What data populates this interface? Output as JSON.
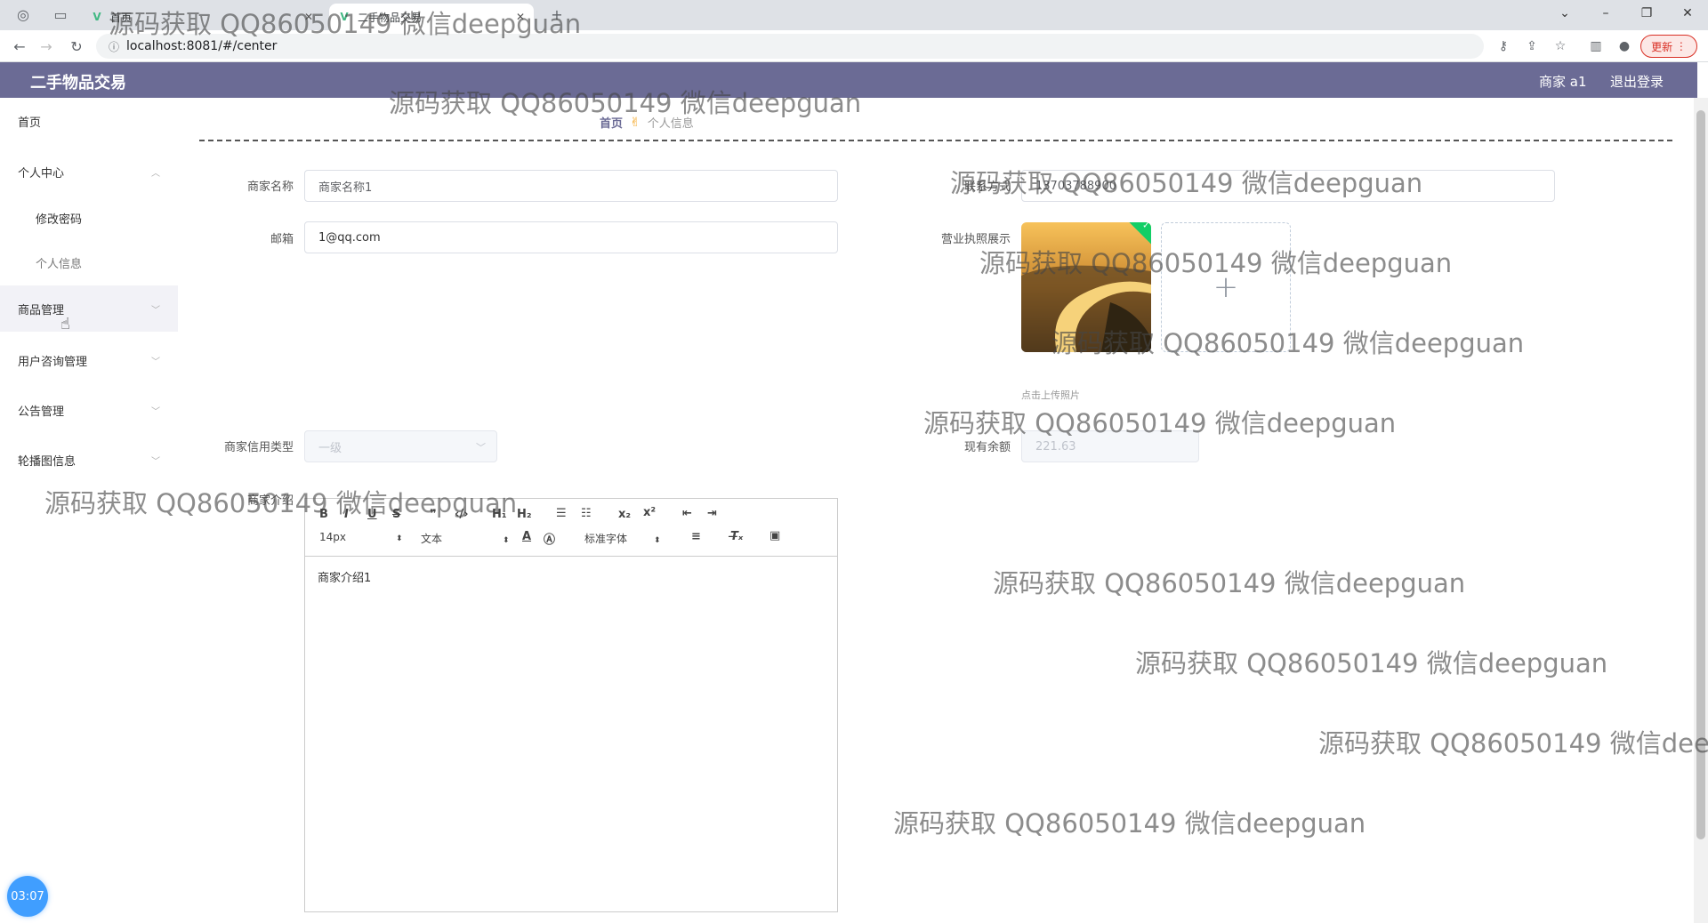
{
  "browser": {
    "tabs": [
      {
        "title": "首页"
      },
      {
        "title": "二手物品交易"
      }
    ],
    "url": "localhost:8081/#/center",
    "update_label": "更新"
  },
  "header": {
    "app_title": "二手物品交易",
    "user_label": "商家 a1",
    "logout_label": "退出登录"
  },
  "sidebar": {
    "items": [
      {
        "label": "首页"
      },
      {
        "label": "个人中心"
      },
      {
        "label": "修改密码"
      },
      {
        "label": "个人信息"
      },
      {
        "label": "商品管理"
      },
      {
        "label": "用户咨询管理"
      },
      {
        "label": "公告管理"
      },
      {
        "label": "轮播图信息"
      }
    ]
  },
  "breadcrumb": {
    "home": "首页",
    "current": "个人信息"
  },
  "form": {
    "merchant_name_label": "商家名称",
    "merchant_name_value": "商家名称1",
    "email_label": "邮箱",
    "email_value": "1@qq.com",
    "contact_label": "联系方式",
    "contact_value": "13703788900",
    "license_label": "营业执照展示",
    "upload_tip": "点击上传照片",
    "credit_label": "商家信用类型",
    "credit_value": "一级",
    "balance_label": "现有余额",
    "balance_value": "221.63",
    "intro_label": "商家介绍",
    "intro_value": "商家介绍1"
  },
  "editor_toolbar": {
    "font_size": "14px",
    "heading": "文本",
    "font_family": "标准字体"
  },
  "timer": "03:07",
  "watermark_text": "源码获取 QQ86050149 微信deepguan",
  "colors": {
    "header_bg": "#6b6b95",
    "active_menu_bg": "#f2f2f7",
    "timer_bg": "#409eff"
  }
}
